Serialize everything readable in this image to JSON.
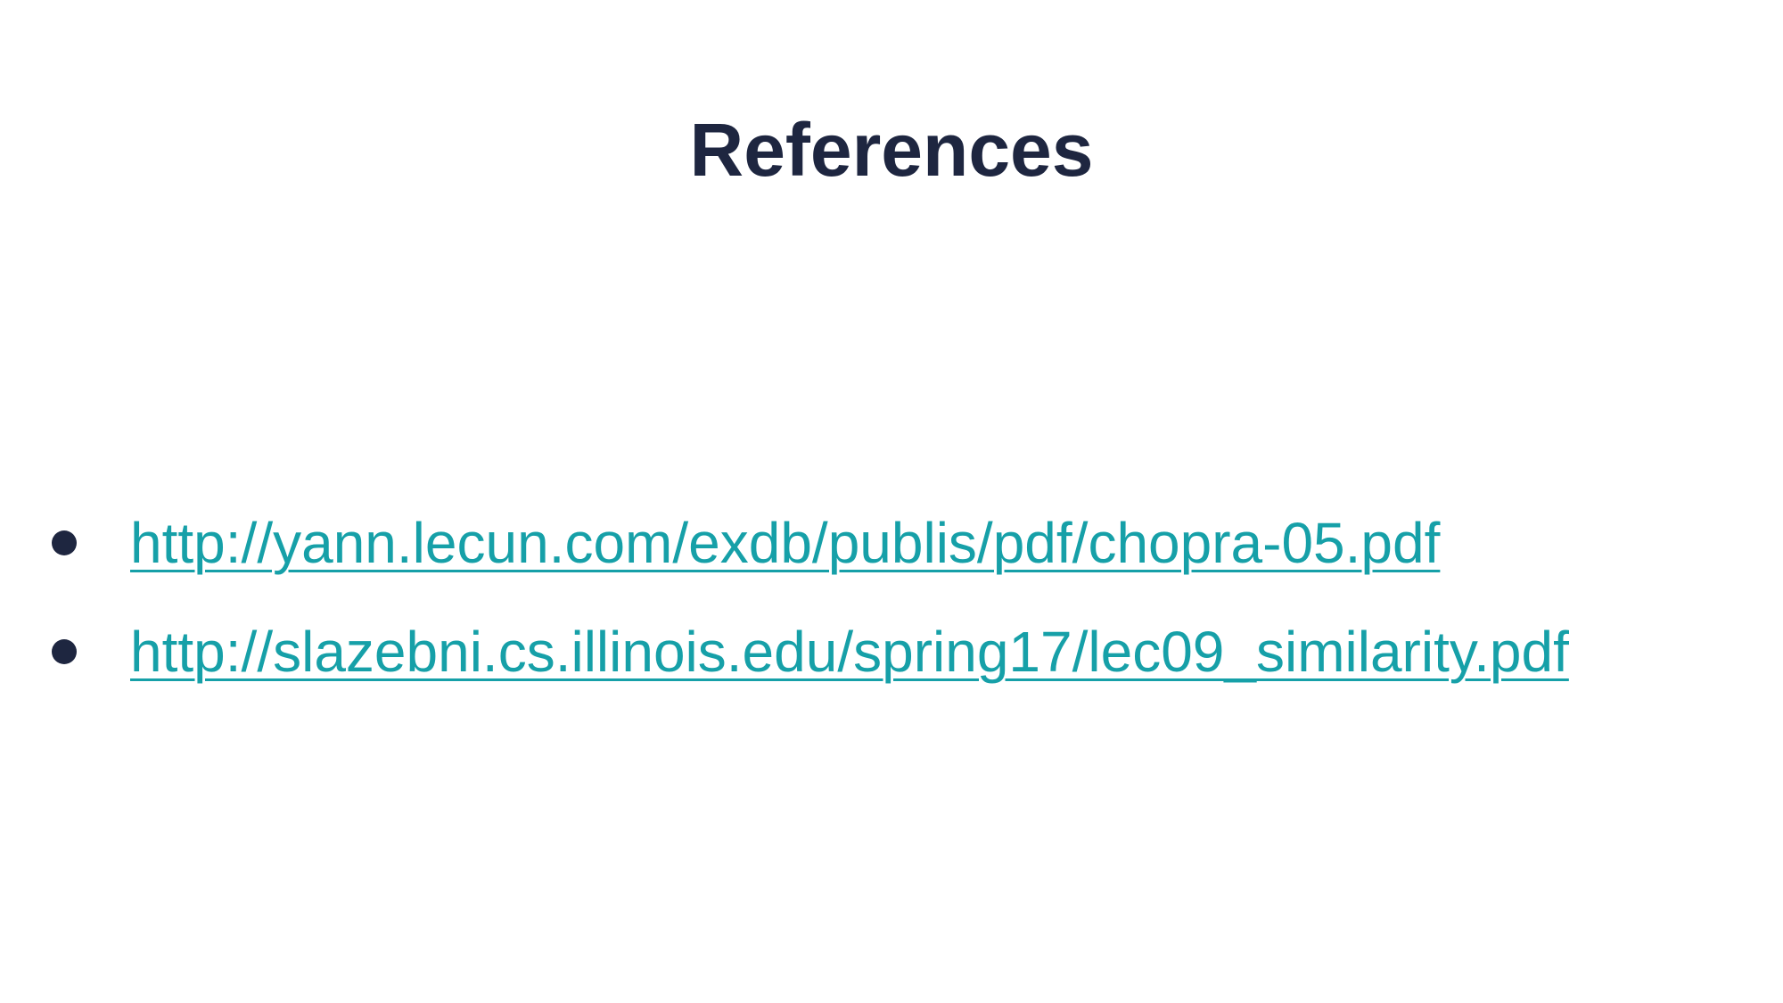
{
  "slide": {
    "title": "References",
    "references": [
      {
        "url": "http://yann.lecun.com/exdb/publis/pdf/chopra-05.pdf"
      },
      {
        "url": "http://slazebni.cs.illinois.edu/spring17/lec09_similarity.pdf"
      }
    ]
  },
  "colors": {
    "title": "#1e2640",
    "bullet": "#1e2640",
    "link": "#16a0a8",
    "background": "#ffffff"
  }
}
